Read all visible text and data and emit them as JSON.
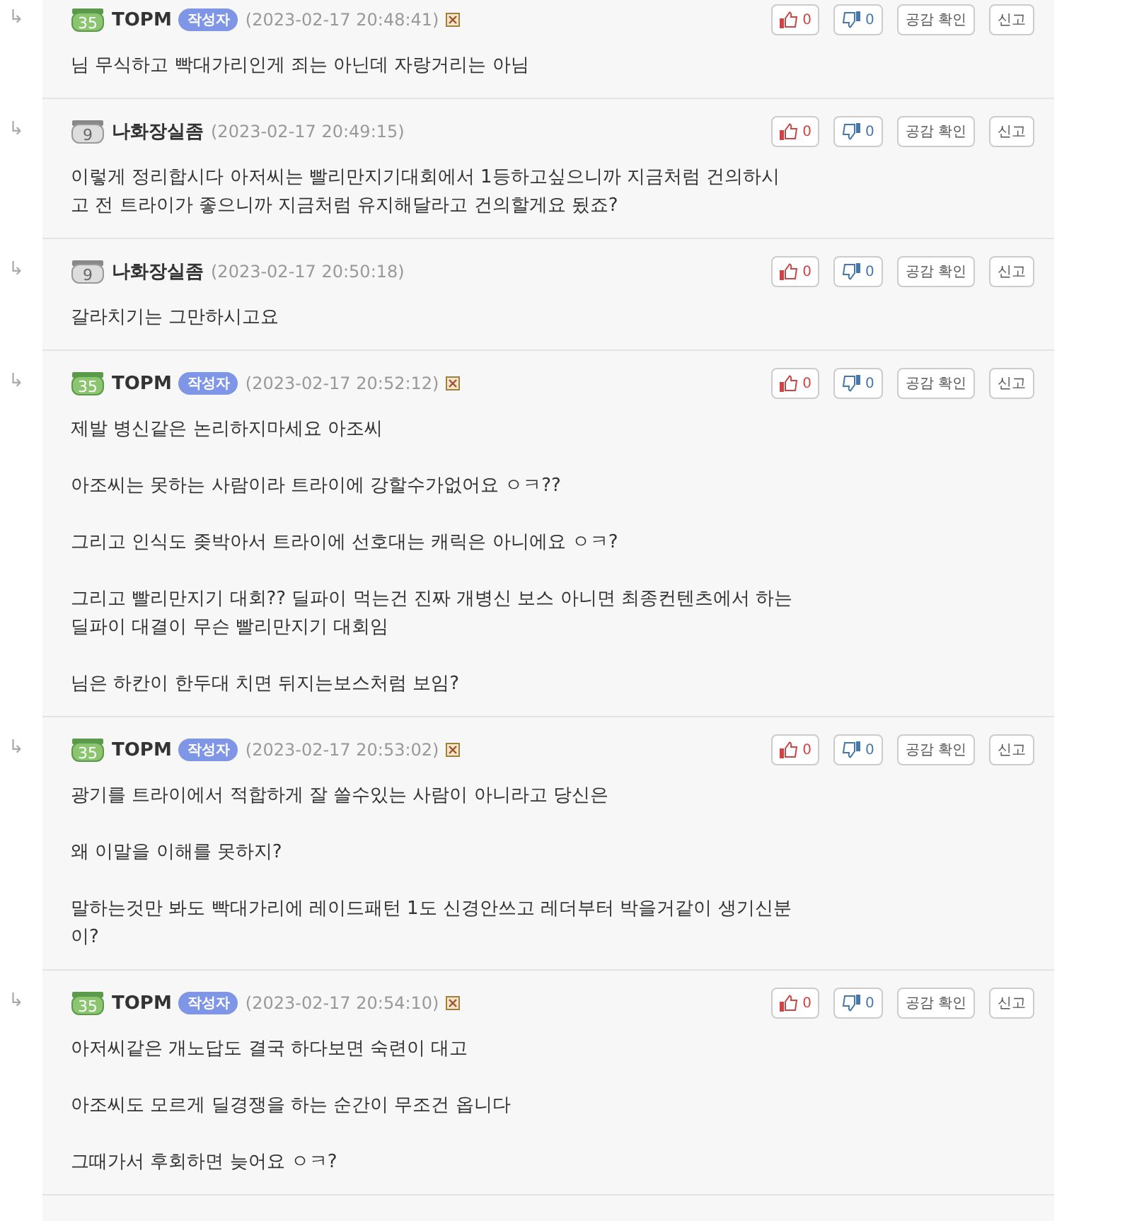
{
  "comments": [
    {
      "reply_mark": "↳",
      "rank": "35",
      "author": "TOPM",
      "writer_tag": "작성자",
      "time": "(2023-02-17 20:48:41)",
      "deletable": true,
      "likes": "0",
      "dislikes": "0",
      "actions": [
        "공감 확인",
        "신고"
      ],
      "paragraphs": [
        "님 무식하고 빡대가리인게 죄는 아닌데 자랑거리는 아님"
      ]
    },
    {
      "reply_mark": "↳",
      "rank": "9",
      "author": "나화장실좀",
      "time": "(2023-02-17 20:49:15)",
      "deletable": false,
      "likes": "0",
      "dislikes": "0",
      "actions": [
        "공감 확인",
        "신고"
      ],
      "paragraphs": [
        "이렇게 정리합시다 아저씨는 빨리만지기대회에서 1등하고싶으니까 지금처럼 건의하시고 전 트라이가 좋으니까 지금처럼 유지해달라고 건의할게요 됬죠?"
      ]
    },
    {
      "reply_mark": "↳",
      "rank": "9",
      "author": "나화장실좀",
      "time": "(2023-02-17 20:50:18)",
      "deletable": false,
      "likes": "0",
      "dislikes": "0",
      "actions": [
        "공감 확인",
        "신고"
      ],
      "paragraphs": [
        "갈라치기는 그만하시고요"
      ]
    },
    {
      "reply_mark": "↳",
      "rank": "35",
      "author": "TOPM",
      "writer_tag": "작성자",
      "time": "(2023-02-17 20:52:12)",
      "deletable": true,
      "likes": "0",
      "dislikes": "0",
      "actions": [
        "공감 확인",
        "신고"
      ],
      "paragraphs": [
        "제발 병신같은 논리하지마세요 아조씨",
        "아조씨는 못하는 사람이라 트라이에 강할수가없어요 ㅇㅋ??",
        "그리고 인식도 좆박아서 트라이에 선호대는 캐릭은 아니에요 ㅇㅋ?",
        "그리고 빨리만지기 대회?? 딜파이 먹는건 진짜 개병신 보스 아니면 최종컨텐츠에서 하는 딜파이 대결이 무슨 빨리만지기 대회임",
        "님은 하칸이 한두대 치면 뒤지는보스처럼 보임?"
      ]
    },
    {
      "reply_mark": "↳",
      "rank": "35",
      "author": "TOPM",
      "writer_tag": "작성자",
      "time": "(2023-02-17 20:53:02)",
      "deletable": true,
      "likes": "0",
      "dislikes": "0",
      "actions": [
        "공감 확인",
        "신고"
      ],
      "paragraphs": [
        "광기를 트라이에서 적합하게 잘 쓸수있는 사람이 아니라고 당신은",
        "왜 이말을 이해를 못하지?",
        "말하는것만 봐도 빡대가리에 레이드패턴 1도 신경안쓰고 레더부터 박을거같이 생기신분이?"
      ]
    },
    {
      "reply_mark": "↳",
      "rank": "35",
      "author": "TOPM",
      "writer_tag": "작성자",
      "time": "(2023-02-17 20:54:10)",
      "deletable": true,
      "likes": "0",
      "dislikes": "0",
      "actions": [
        "공감 확인",
        "신고"
      ],
      "paragraphs": [
        "아저씨같은 개노답도 결국 하다보면 숙련이 대고",
        "아조씨도 모르게 딜경쟁을 하는 순간이 무조건 옵니다",
        "그때가서 후회하면 늦어요 ㅇㅋ?"
      ]
    }
  ]
}
